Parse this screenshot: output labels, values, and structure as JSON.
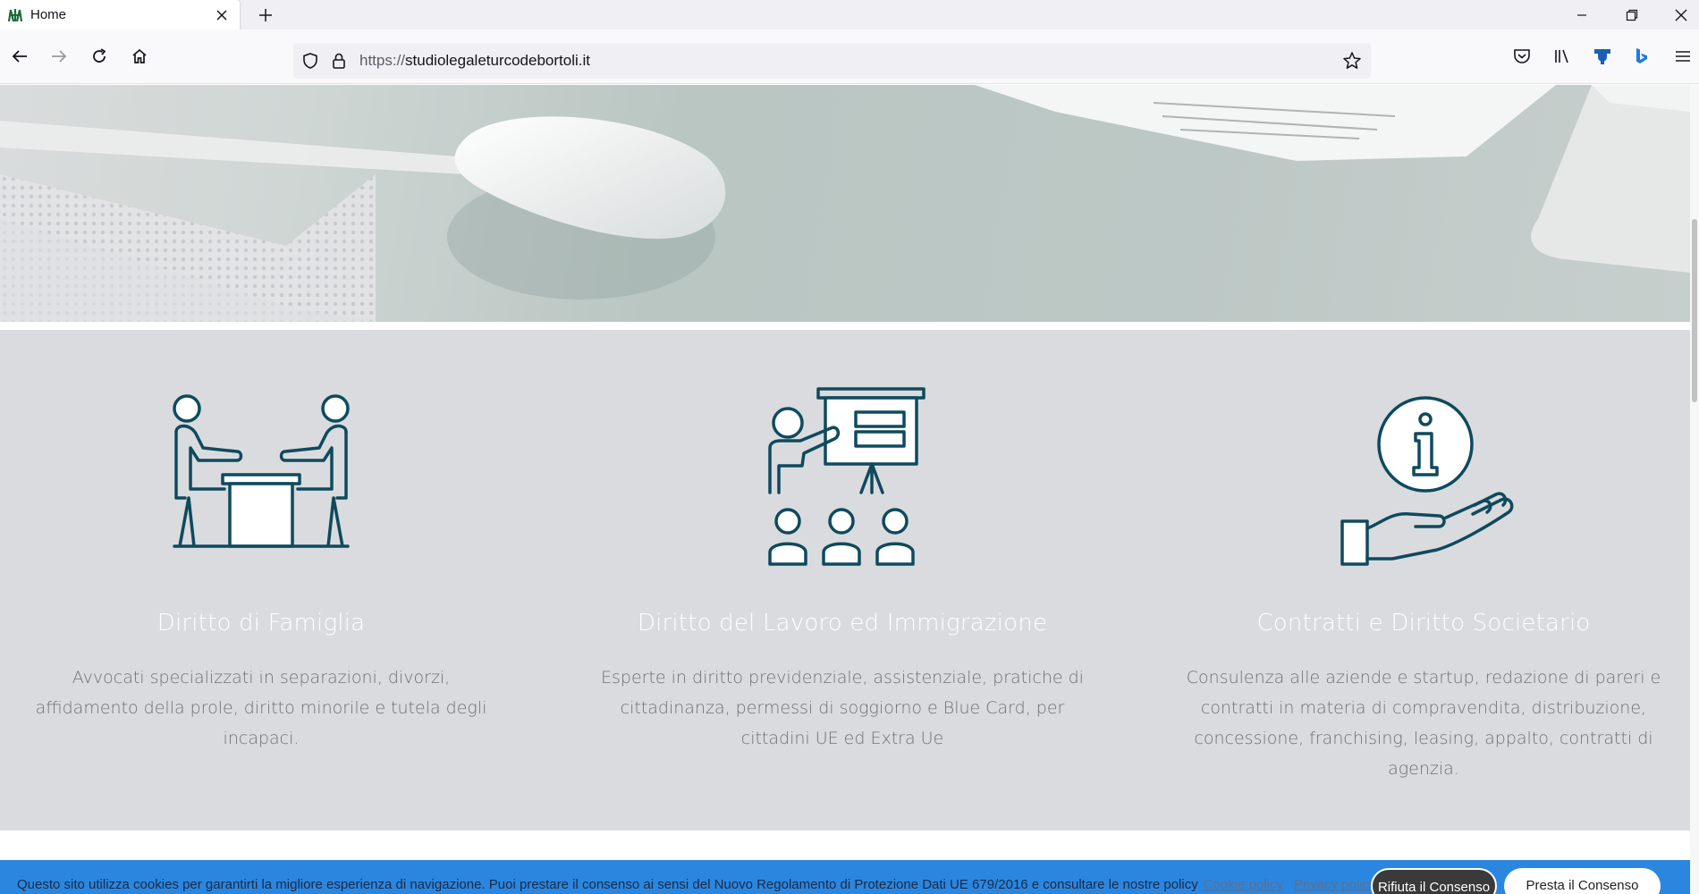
{
  "browser": {
    "tab_title": "Home",
    "url_scheme": "https://",
    "url_host": "studiolegaleturcodebortoli.it",
    "icons": [
      "back-icon",
      "forward-icon",
      "reload-icon",
      "home-icon",
      "shield-icon",
      "lock-icon",
      "bookmark-star-icon",
      "pocket-icon",
      "library-icon",
      "extension-icon",
      "bing-icon",
      "menu-icon"
    ]
  },
  "services": [
    {
      "title": "Diritto di Famiglia",
      "lines": [
        "Avvocati specializzati in separazioni, divorzi,",
        "affidamento della prole, diritto minorile e tutela degli",
        "incapaci."
      ],
      "icon": "meeting-icon"
    },
    {
      "title": "Diritto del Lavoro ed Immigrazione",
      "lines": [
        "Esperte in diritto previdenziale, assistenziale, pratiche di",
        "cittadinanza, permessi di soggiorno e Blue Card, per",
        "cittadini UE ed Extra Ue"
      ],
      "icon": "presentation-icon"
    },
    {
      "title": "Contratti e Diritto Societario",
      "lines": [
        "Consulenza alle aziende e startup, redazione di pareri e",
        "contratti in materia di compravendita, distribuzione,",
        "concessione, franchising, leasing, appalto, contratti di",
        "agenzia."
      ],
      "icon": "info-hand-icon"
    }
  ],
  "cookie": {
    "text": "Questo sito utilizza cookies per garantirti la migliore esperienza di navigazione. Puoi prestare il consenso ai sensi del Nuovo Regolamento di Protezione Dati UE 679/2016 e consultare le nostre policy",
    "cookie_policy": "Cookie policy",
    "privacy_policy": "Privacy policy",
    "refuse": "Rifiuta il Consenso",
    "accept": "Presta il Consenso"
  },
  "colors": {
    "icon_stroke": "#0e4a5e",
    "services_bg": "#dadbde",
    "cookie_bar": "#2b86e0"
  }
}
